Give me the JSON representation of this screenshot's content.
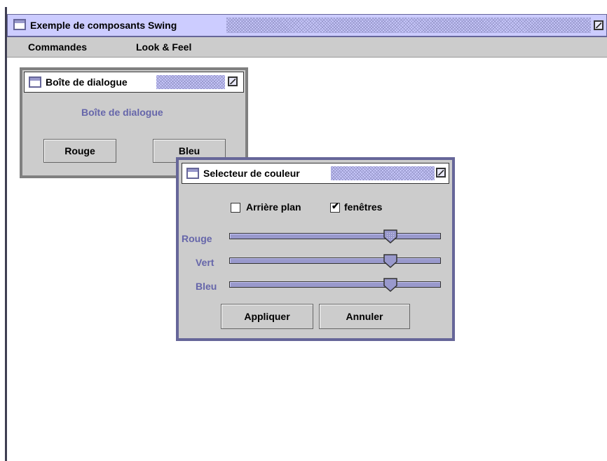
{
  "main_window": {
    "title": "Exemple de composants Swing",
    "menu": [
      "Commandes",
      "Look & Feel"
    ]
  },
  "dialog": {
    "title": "Boîte de dialogue",
    "label": "Boîte de dialogue",
    "buttons": [
      "Rouge",
      "Bleu"
    ]
  },
  "color_selector": {
    "title": "Selecteur de couleur",
    "checkboxes": [
      {
        "label": "Arrière plan",
        "checked": false
      },
      {
        "label": "fenêtres",
        "checked": true
      }
    ],
    "sliders": [
      {
        "label": "Rouge",
        "value": 0.76
      },
      {
        "label": "Vert",
        "value": 0.76
      },
      {
        "label": "Bleu",
        "value": 0.76
      }
    ],
    "buttons": {
      "apply": "Appliquer",
      "cancel": "Annuler"
    }
  },
  "colors": {
    "titlebar": "#ccccff",
    "accent": "#666699",
    "label_blue": "#6666aa",
    "panel": "#cccccc"
  }
}
